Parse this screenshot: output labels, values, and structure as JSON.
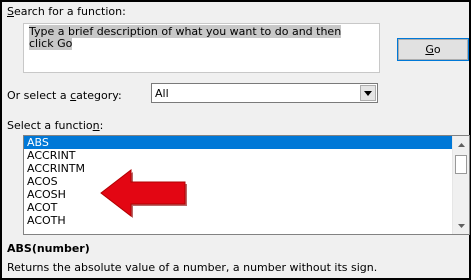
{
  "search": {
    "label_pre": "",
    "label_key": "S",
    "label_post": "earch for a function:",
    "input_value": "Type a brief description of what you want to do and then click Go",
    "go_pre": "",
    "go_key": "G",
    "go_post": "o"
  },
  "category": {
    "label_pre": "Or select a ",
    "label_key": "c",
    "label_post": "ategory:",
    "selected": "All"
  },
  "functions": {
    "label_pre": "Select a functio",
    "label_key": "n",
    "label_post": ":",
    "items": [
      "ABS",
      "ACCRINT",
      "ACCRINTM",
      "ACOS",
      "ACOSH",
      "ACOT",
      "ACOTH"
    ],
    "selected_index": 0
  },
  "details": {
    "syntax": "ABS(number)",
    "description": "Returns the absolute value of a number, a number without its sign."
  },
  "annotation": {
    "arrow_color": "#e30613",
    "arrow_dark": "#8a0000"
  },
  "icons": {
    "dropdown": "chevron-down-icon",
    "scroll_up": "scroll-up-icon",
    "scroll_down": "scroll-down-icon",
    "arrow": "red-arrow-annotation"
  }
}
